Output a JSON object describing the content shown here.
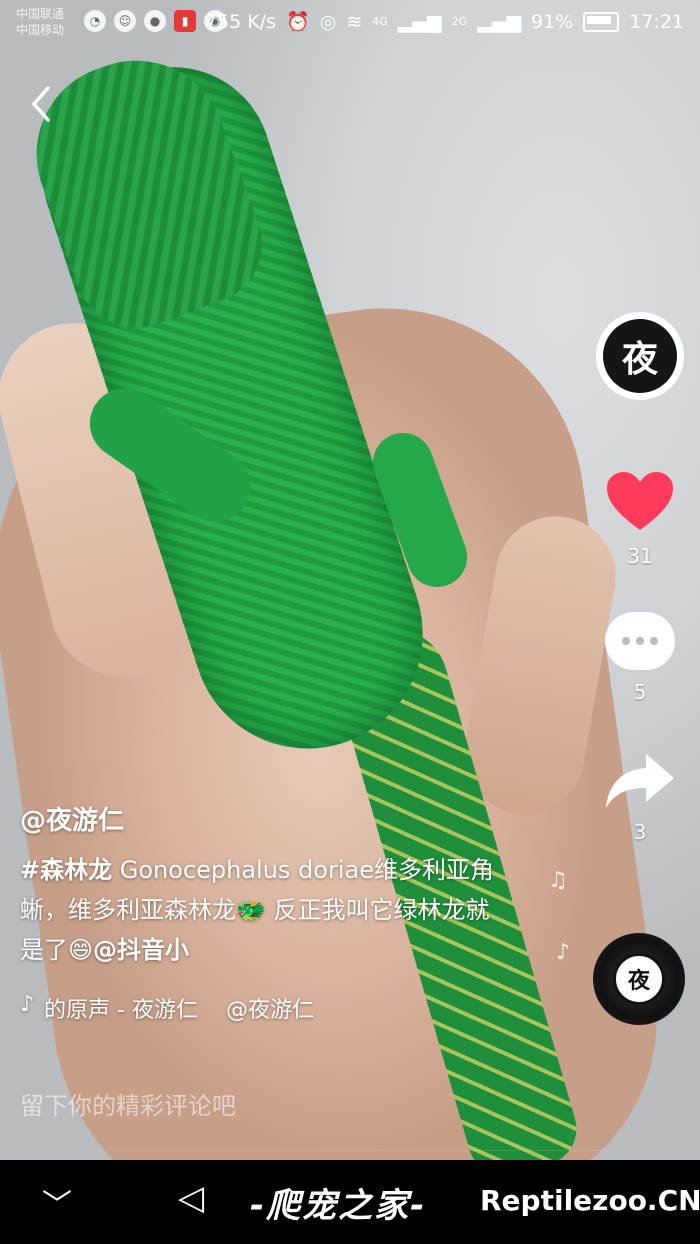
{
  "status_bar": {
    "carrier_1": "中国联通",
    "carrier_2": "中国移动",
    "speed": "755 K/s",
    "network_1": "4G",
    "network_2": "2G",
    "battery": "91%",
    "time": "17:21",
    "icons": [
      "qq-icon",
      "cat-icon",
      "chat-icon",
      "mic-icon",
      "circle-icon"
    ]
  },
  "nav": {
    "back_icon": "chevron-left-icon"
  },
  "author": {
    "avatar_text": "夜",
    "username": "@夜游仁"
  },
  "actions": {
    "likes": "31",
    "comments": "5",
    "shares": "3",
    "like_color": "#ff3b5c"
  },
  "description": {
    "hashtag": "#森林龙",
    "text_1": " Gonocephalus doriae维多利亚角蜥，维多利亚森林龙",
    "emoji_1": "🐲",
    "text_2": " 反正我叫它绿林龙就是了",
    "emoji_2": "😄",
    "mention": "@抖音小"
  },
  "music": {
    "note": "♪",
    "title": "的原声 - 夜游仁",
    "mention": "@夜游仁"
  },
  "comment": {
    "placeholder": "留下你的精彩评论吧"
  },
  "bottom_bar": {
    "chevron": "﹀",
    "back_triangle": "◁",
    "watermark_cn": "-爬宠之家-",
    "watermark_en": "Reptilezoo.CN"
  }
}
